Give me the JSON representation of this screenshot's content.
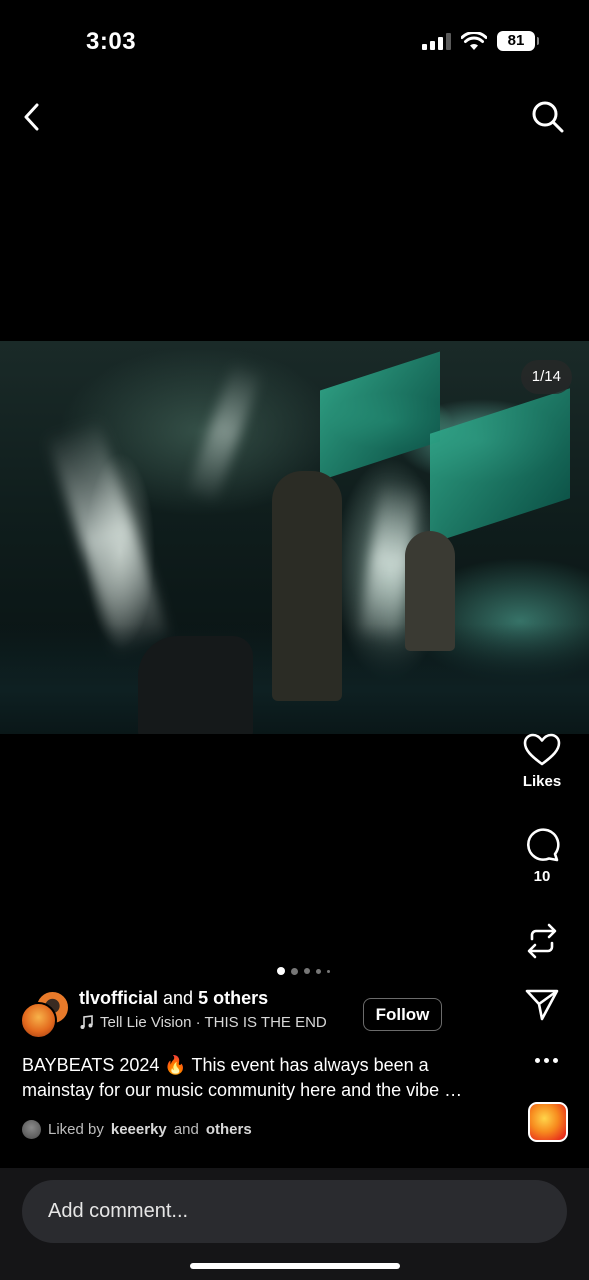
{
  "status_bar": {
    "time": "3:03",
    "battery": "81"
  },
  "nav": {
    "back_icon": "chevron-left-icon",
    "search_icon": "search-icon"
  },
  "post": {
    "image_counter": "1/14",
    "carousel_dots": 5,
    "active_dot": 0
  },
  "actions": {
    "likes_label": "Likes",
    "comments_count": "10",
    "icons": [
      "heart-icon",
      "comment-icon",
      "repost-icon",
      "send-icon",
      "more-icon"
    ]
  },
  "author": {
    "username": "tlvofficial",
    "and_text": "and",
    "others": "5 others",
    "music": "Tell Lie Vision · THIS IS THE END",
    "follow_label": "Follow"
  },
  "caption": {
    "text": "BAYBEATS 2024 🔥 This event has always been a mainstay for our music community here and the vibe …"
  },
  "liked_by": {
    "prefix": "Liked by",
    "user": "keeerky",
    "middle": "and",
    "suffix": "others"
  },
  "comment": {
    "placeholder": "Add comment..."
  }
}
